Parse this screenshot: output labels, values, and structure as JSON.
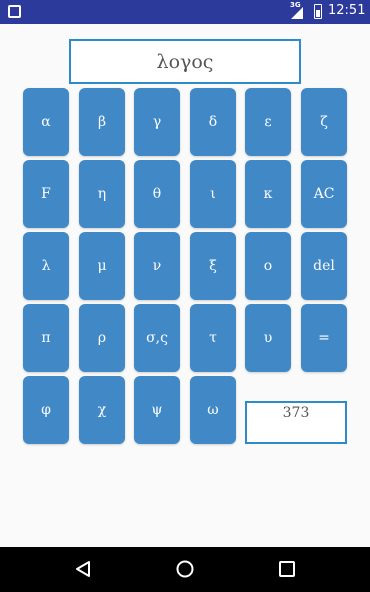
{
  "status_bar": {
    "network": "3G",
    "time": "12:51"
  },
  "word_display": "λογος",
  "keys": [
    [
      "α",
      "β",
      "γ",
      "δ",
      "ε",
      "ζ"
    ],
    [
      "F",
      "η",
      "θ",
      "ι",
      "κ",
      "AC"
    ],
    [
      "λ",
      "μ",
      "ν",
      "ξ",
      "ο",
      "del"
    ],
    [
      "π",
      "ρ",
      "σ,ς",
      "τ",
      "υ",
      "="
    ],
    [
      "φ",
      "χ",
      "ψ",
      "ω"
    ]
  ],
  "result": "373",
  "icons": {
    "back": "back-triangle-icon",
    "home": "home-circle-icon",
    "recents": "recents-square-icon"
  }
}
